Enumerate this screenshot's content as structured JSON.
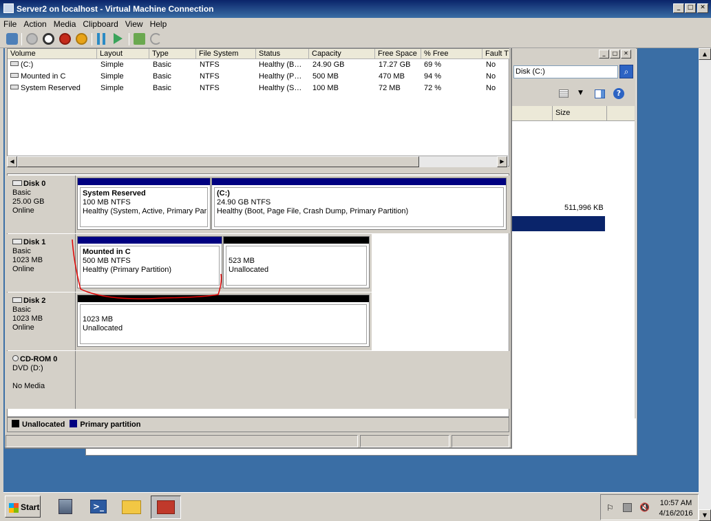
{
  "window": {
    "title": "Server2 on localhost - Virtual Machine Connection"
  },
  "menu": [
    "File",
    "Action",
    "Media",
    "Clipboard",
    "View",
    "Help"
  ],
  "columns": [
    "Volume",
    "Layout",
    "Type",
    "File System",
    "Status",
    "Capacity",
    "Free Space",
    "% Free",
    "Fault T"
  ],
  "volumes": [
    {
      "name": "(C:)",
      "layout": "Simple",
      "type": "Basic",
      "fs": "NTFS",
      "status": "Healthy (B…",
      "capacity": "24.90 GB",
      "free": "17.27 GB",
      "pct": "69 %",
      "fault": "No"
    },
    {
      "name": "Mounted in C",
      "layout": "Simple",
      "type": "Basic",
      "fs": "NTFS",
      "status": "Healthy (P…",
      "capacity": "500 MB",
      "free": "470 MB",
      "pct": "94 %",
      "fault": "No"
    },
    {
      "name": "System Reserved",
      "layout": "Simple",
      "type": "Basic",
      "fs": "NTFS",
      "status": "Healthy (S…",
      "capacity": "100 MB",
      "free": "72 MB",
      "pct": "72 %",
      "fault": "No"
    }
  ],
  "disks": [
    {
      "label": "Disk 0",
      "type": "Basic",
      "size": "25.00 GB",
      "state": "Online",
      "partitions": [
        {
          "title": "System Reserved",
          "line1": "100 MB NTFS",
          "line2": "Healthy (System, Active, Primary Par"
        },
        {
          "title": "(C:)",
          "line1": "24.90 GB NTFS",
          "line2": "Healthy (Boot, Page File, Crash Dump, Primary Partition)"
        }
      ]
    },
    {
      "label": "Disk 1",
      "type": "Basic",
      "size": "1023 MB",
      "state": "Online",
      "partitions": [
        {
          "title": "Mounted in C",
          "line1": "500 MB NTFS",
          "line2": "Healthy (Primary Partition)"
        },
        {
          "title": "",
          "line1": "523 MB",
          "line2": "Unallocated"
        }
      ]
    },
    {
      "label": "Disk 2",
      "type": "Basic",
      "size": "1023 MB",
      "state": "Online",
      "partitions": [
        {
          "title": "",
          "line1": "1023 MB",
          "line2": "Unallocated"
        }
      ]
    }
  ],
  "cdrom": {
    "label": "CD-ROM 0",
    "drive": "DVD (D:)",
    "media": "No Media"
  },
  "legend": {
    "unallocated": "Unallocated",
    "primary": "Primary partition"
  },
  "background_window": {
    "search_value": "Disk (C:)",
    "size_header": "Size",
    "size_value": "511,996 KB"
  },
  "taskbar": {
    "start": "Start",
    "time": "10:57 AM",
    "date": "4/16/2016"
  },
  "colors": {
    "primary_partition": "#000080",
    "unallocated": "#000000",
    "desktop": "#3a6ea5",
    "annotation": "#e00000"
  }
}
